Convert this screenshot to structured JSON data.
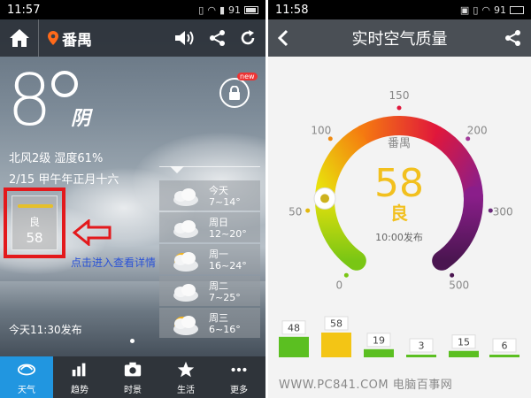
{
  "left": {
    "status": {
      "time": "11:57",
      "battery": "91"
    },
    "topbar": {
      "city": "番禺"
    },
    "weather": {
      "temp": "8",
      "condition": "阴",
      "wind_humidity": "北风2级 湿度61%",
      "date": "2/15 甲午年正月十六"
    },
    "badge_new": "new",
    "aqi_card": {
      "level": "良",
      "value": "58",
      "level_bar_color": "#e6c02a"
    },
    "hint": "点击进入查看详情",
    "forecast": [
      {
        "day": "今天",
        "range": "7~14°",
        "icon": "cloudy-icon"
      },
      {
        "day": "周日",
        "range": "12~20°",
        "icon": "cloudy-icon"
      },
      {
        "day": "周一",
        "range": "16~24°",
        "icon": "partly-sunny-icon"
      },
      {
        "day": "周二",
        "range": "7~25°",
        "icon": "cloudy-icon"
      },
      {
        "day": "周三",
        "range": "6~16°",
        "icon": "partly-sunny-icon"
      }
    ],
    "publish_time": "今天11:30发布",
    "nav": [
      {
        "label": "天气",
        "icon": "weather-icon",
        "active": true
      },
      {
        "label": "趋势",
        "icon": "trend-icon",
        "active": false
      },
      {
        "label": "时景",
        "icon": "camera-icon",
        "active": false
      },
      {
        "label": "生活",
        "icon": "star-icon",
        "active": false
      },
      {
        "label": "更多",
        "icon": "more-icon",
        "active": false
      }
    ]
  },
  "right": {
    "status": {
      "time": "11:58",
      "battery": "91"
    },
    "title": "实时空气质量",
    "gauge": {
      "city": "番禺",
      "value": "58",
      "level": "良",
      "publish": "10:00发布",
      "ticks": [
        "0",
        "50",
        "100",
        "150",
        "200",
        "300",
        "500"
      ],
      "value_color": "#f2c01e"
    },
    "bars": {
      "labels": [
        "48",
        "58",
        "19",
        "3",
        "15",
        "6"
      ],
      "values": [
        48,
        58,
        19,
        3,
        15,
        6
      ],
      "colors": [
        "#5bbf21",
        "#f3c515",
        "#5bbf21",
        "#5bbf21",
        "#5bbf21",
        "#5bbf21"
      ]
    }
  },
  "watermark": "WWW.PC841.COM 电脑百事网"
}
